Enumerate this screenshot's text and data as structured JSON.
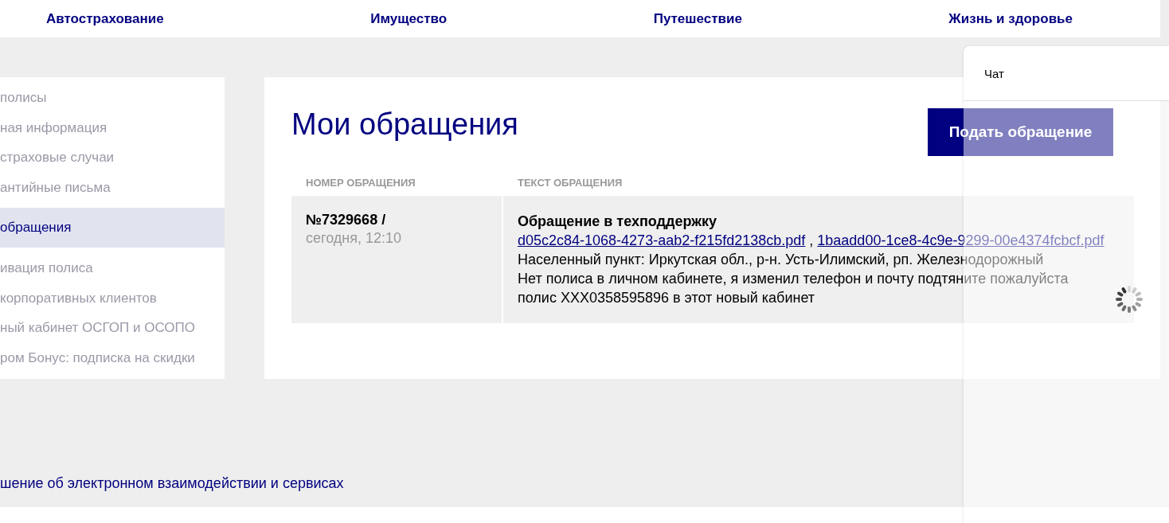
{
  "nav": [
    {
      "label": "Автострахование"
    },
    {
      "label": "Имущество"
    },
    {
      "label": "Путешествие"
    },
    {
      "label": "Жизнь и здоровье"
    }
  ],
  "sidebar": {
    "items": [
      {
        "label": "полисы",
        "selected": false
      },
      {
        "label": "ная информация",
        "selected": false
      },
      {
        "label": "страховые случаи",
        "selected": false
      },
      {
        "label": "антийные письма",
        "selected": false
      },
      {
        "label": "обращения",
        "selected": true
      },
      {
        "label": "ивация полиса",
        "selected": false
      },
      {
        "label": "корпоративных клиентов",
        "selected": false
      },
      {
        "label": "ный кабинет ОСГОП и ОСОПО",
        "selected": false
      },
      {
        "label": "ром Бонус: подписка на скидки",
        "selected": false
      }
    ]
  },
  "main": {
    "title": "Мои обращения",
    "submit_button": "Подать обращение",
    "table": {
      "columns": [
        "НОМЕР ОБРАЩЕНИЯ",
        "ТЕКСТ ОБРАЩЕНИЯ"
      ],
      "rows": [
        {
          "number": "№7329668 /",
          "date": "сегодня, 12:10",
          "subject": "Обращение в техподдержку",
          "files": [
            "d05c2c84-1068-4273-aab2-f215fd2138cb.pdf",
            "1baadd00-1ce8-4c9e-9299-00e4374fcbcf.pdf"
          ],
          "file_separator": ",",
          "lines": [
            "Населенный пункт: Иркутская обл., р-н. Усть-Илимский, рп. Железнодорожный",
            "Нет полиса в личном кабинете, я изменил телефон и почту подтяните пожалуйста полис XXX0358595896 в этот новый кабинет"
          ]
        }
      ]
    }
  },
  "footer": {
    "link": "шение об электронном взаимодействии и сервисах"
  },
  "chat": {
    "title": "Чат",
    "loading": true
  }
}
